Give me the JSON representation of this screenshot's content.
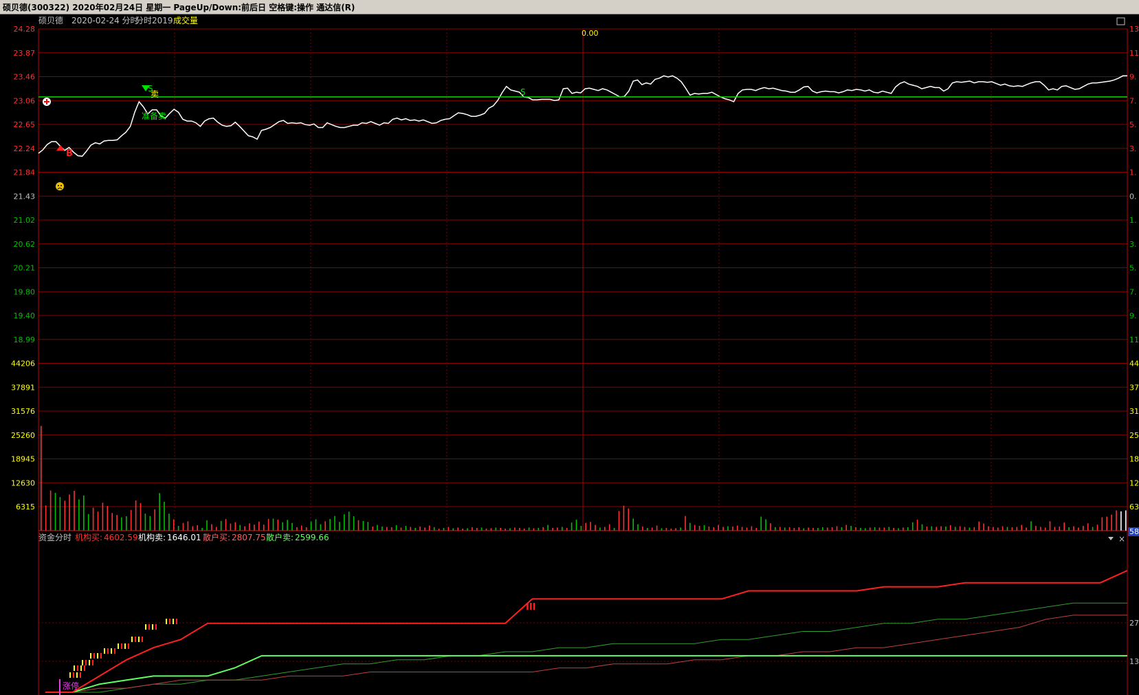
{
  "window": {
    "title": "硕贝德(300322)  2020年02月24日 星期一  PageUp/Down:前后日 空格键:操作 通达信(R)"
  },
  "header": {
    "stock_name": "硕贝德",
    "date_label": "2020-02-24 分时",
    "mode_label": "分时2019",
    "indicator_label": "成交量"
  },
  "colors": {
    "background": "#000000",
    "grid": "#8b0000",
    "price_line": "#ffffff",
    "ref_line": "#00e000",
    "up": "#ff3030",
    "down": "#00c000",
    "yellow": "#ffff00"
  },
  "price_axis": {
    "ticks": [
      "24.28",
      "23.87",
      "23.46",
      "23.06",
      "22.65",
      "22.24",
      "21.84",
      "21.43",
      "21.02",
      "20.62",
      "20.21",
      "19.80",
      "19.40",
      "18.99"
    ],
    "reference": "21.43"
  },
  "right_axis": {
    "price_ticks": [
      "13",
      "11",
      "9.",
      "7.",
      "5.",
      "3.",
      "1.",
      "0.",
      "1.",
      "3.",
      "5.",
      "7.",
      "9.",
      "11"
    ],
    "volume_ticks": [
      "44",
      "37",
      "31",
      "25",
      "18",
      "12",
      "63"
    ],
    "current_badge": "58",
    "fund_ticks": [
      "27",
      "13"
    ]
  },
  "volume_axis": {
    "ticks": [
      "44206",
      "37891",
      "31576",
      "25260",
      "18945",
      "12630",
      "6315"
    ]
  },
  "center_label": "0.00",
  "signals": {
    "buy": "B",
    "sell": "S",
    "sell_text": "卖",
    "prepare_sell": "准备卖",
    "s_marker": "S",
    "limit_up": "涨停",
    "triple_mark": "III"
  },
  "fund_panel": {
    "title": "资金分时",
    "inst_buy_label": "机构买:",
    "inst_buy_value": "4602.59",
    "inst_sell_label": "机构卖:",
    "inst_sell_value": "1646.01",
    "retail_buy_label": "散户买:",
    "retail_buy_value": "2807.75",
    "retail_sell_label": "散户卖:",
    "retail_sell_value": "2599.66"
  },
  "chart_data": {
    "type": "line",
    "price_series": [
      22.16,
      22.22,
      22.31,
      22.36,
      22.36,
      22.28,
      22.21,
      22.26,
      22.18,
      22.12,
      22.11,
      22.2,
      22.3,
      22.34,
      22.32,
      22.37,
      22.38,
      22.38,
      22.39,
      22.46,
      22.52,
      22.62,
      22.86,
      23.04,
      22.95,
      22.83,
      22.9,
      22.9,
      22.8,
      22.76,
      22.84,
      22.91,
      22.86,
      22.74,
      22.71,
      22.71,
      22.68,
      22.62,
      22.71,
      22.75,
      22.76,
      22.69,
      22.64,
      22.62,
      22.63,
      22.69,
      22.62,
      22.54,
      22.46,
      22.44,
      22.4,
      22.55,
      22.57,
      22.6,
      22.65,
      22.7,
      22.72,
      22.67,
      22.68,
      22.67,
      22.68,
      22.65,
      22.64,
      22.66,
      22.6,
      22.6,
      22.68,
      22.65,
      22.62,
      22.6,
      22.6,
      22.62,
      22.64,
      22.64,
      22.68,
      22.67,
      22.7,
      22.67,
      22.64,
      22.68,
      22.67,
      22.74,
      22.76,
      22.73,
      22.75,
      22.72,
      22.73,
      22.71,
      22.73,
      22.7,
      22.67,
      22.68,
      22.72,
      22.74,
      22.75,
      22.8,
      22.85,
      22.84,
      22.82,
      22.79,
      22.79,
      22.81,
      22.84,
      22.93,
      22.97,
      23.06,
      23.19,
      23.3,
      23.24,
      23.22,
      23.2,
      23.12,
      23.11,
      23.07,
      23.07,
      23.08,
      23.08,
      23.08,
      23.06,
      23.07,
      23.26,
      23.27,
      23.18,
      23.2,
      23.19,
      23.26,
      23.27,
      23.25,
      23.23,
      23.26,
      23.24,
      23.2,
      23.16,
      23.12,
      23.13,
      23.22,
      23.39,
      23.41,
      23.33,
      23.36,
      23.34,
      23.42,
      23.44,
      23.48,
      23.46,
      23.48,
      23.44,
      23.38,
      23.27,
      23.15,
      23.18,
      23.17,
      23.18,
      23.18,
      23.2,
      23.16,
      23.12,
      23.09,
      23.07,
      23.04,
      23.18,
      23.24,
      23.25,
      23.25,
      23.23,
      23.26,
      23.28,
      23.26,
      23.27,
      23.25,
      23.23,
      23.22,
      23.2,
      23.2,
      23.24,
      23.29,
      23.3,
      23.22,
      23.19,
      23.21,
      23.22,
      23.21,
      23.21,
      23.19,
      23.21,
      23.24,
      23.23,
      23.25,
      23.24,
      23.22,
      23.24,
      23.2,
      23.19,
      23.22,
      23.2,
      23.18,
      23.29,
      23.35,
      23.38,
      23.34,
      23.32,
      23.3,
      23.26,
      23.28,
      23.3,
      23.28,
      23.28,
      23.22,
      23.26,
      23.36,
      23.38,
      23.37,
      23.38,
      23.39,
      23.36,
      23.38,
      23.38,
      23.37,
      23.38,
      23.35,
      23.32,
      23.34,
      23.31,
      23.3,
      23.31,
      23.3,
      23.33,
      23.36,
      23.38,
      23.38,
      23.32,
      23.24,
      23.26,
      23.24,
      23.3,
      23.31,
      23.28,
      23.25,
      23.26,
      23.3,
      23.34,
      23.36,
      23.36,
      23.37,
      23.38,
      23.39,
      23.41,
      23.44,
      23.48,
      23.48
    ],
    "volume_series": [
      {
        "v": 31600,
        "c": "up"
      },
      {
        "v": 7600,
        "c": "up"
      },
      {
        "v": 12100,
        "c": "up"
      },
      {
        "v": 11400,
        "c": "down"
      },
      {
        "v": 10100,
        "c": "down"
      },
      {
        "v": 9000,
        "c": "up"
      },
      {
        "v": 10900,
        "c": "up"
      },
      {
        "v": 12000,
        "c": "up"
      },
      {
        "v": 9400,
        "c": "down"
      },
      {
        "v": 10600,
        "c": "down"
      },
      {
        "v": 5000,
        "c": "down"
      },
      {
        "v": 6900,
        "c": "up"
      },
      {
        "v": 5700,
        "c": "up"
      },
      {
        "v": 8400,
        "c": "up"
      },
      {
        "v": 7400,
        "c": "up"
      },
      {
        "v": 5300,
        "c": "up"
      },
      {
        "v": 4700,
        "c": "up"
      },
      {
        "v": 4000,
        "c": "down"
      },
      {
        "v": 4300,
        "c": "down"
      },
      {
        "v": 6200,
        "c": "up"
      },
      {
        "v": 9100,
        "c": "up"
      },
      {
        "v": 8300,
        "c": "up"
      },
      {
        "v": 5100,
        "c": "down"
      },
      {
        "v": 4400,
        "c": "down"
      },
      {
        "v": 6400,
        "c": "up"
      },
      {
        "v": 11300,
        "c": "down"
      },
      {
        "v": 8700,
        "c": "down"
      },
      {
        "v": 5100,
        "c": "down"
      },
      {
        "v": 3400,
        "c": "up"
      },
      {
        "v": 1400,
        "c": "down"
      },
      {
        "v": 2300,
        "c": "up"
      },
      {
        "v": 2800,
        "c": "up"
      },
      {
        "v": 1300,
        "c": "up"
      },
      {
        "v": 1600,
        "c": "up"
      },
      {
        "v": 800,
        "c": "down"
      },
      {
        "v": 3100,
        "c": "down"
      },
      {
        "v": 1900,
        "c": "up"
      },
      {
        "v": 1100,
        "c": "up"
      },
      {
        "v": 2900,
        "c": "down"
      },
      {
        "v": 3500,
        "c": "up"
      },
      {
        "v": 2100,
        "c": "up"
      },
      {
        "v": 2500,
        "c": "up"
      },
      {
        "v": 1700,
        "c": "down"
      },
      {
        "v": 1300,
        "c": "up"
      },
      {
        "v": 2200,
        "c": "up"
      },
      {
        "v": 1800,
        "c": "up"
      },
      {
        "v": 2700,
        "c": "up"
      },
      {
        "v": 1800,
        "c": "up"
      },
      {
        "v": 3500,
        "c": "up"
      },
      {
        "v": 3600,
        "c": "down"
      },
      {
        "v": 3300,
        "c": "up"
      },
      {
        "v": 2500,
        "c": "down"
      },
      {
        "v": 3200,
        "c": "down"
      },
      {
        "v": 2300,
        "c": "down"
      },
      {
        "v": 1000,
        "c": "up"
      },
      {
        "v": 1500,
        "c": "up"
      },
      {
        "v": 1000,
        "c": "up"
      },
      {
        "v": 2700,
        "c": "down"
      },
      {
        "v": 3400,
        "c": "down"
      },
      {
        "v": 1900,
        "c": "down"
      },
      {
        "v": 2800,
        "c": "up"
      },
      {
        "v": 3500,
        "c": "down"
      },
      {
        "v": 4400,
        "c": "down"
      },
      {
        "v": 2600,
        "c": "down"
      },
      {
        "v": 4900,
        "c": "down"
      },
      {
        "v": 5700,
        "c": "down"
      },
      {
        "v": 4300,
        "c": "down"
      },
      {
        "v": 3100,
        "c": "up"
      },
      {
        "v": 2900,
        "c": "down"
      },
      {
        "v": 2600,
        "c": "down"
      },
      {
        "v": 1200,
        "c": "up"
      },
      {
        "v": 1700,
        "c": "down"
      },
      {
        "v": 1200,
        "c": "down"
      },
      {
        "v": 1100,
        "c": "up"
      },
      {
        "v": 1000,
        "c": "up"
      },
      {
        "v": 1600,
        "c": "down"
      },
      {
        "v": 900,
        "c": "up"
      },
      {
        "v": 1400,
        "c": "down"
      },
      {
        "v": 1100,
        "c": "up"
      },
      {
        "v": 800,
        "c": "down"
      },
      {
        "v": 1200,
        "c": "up"
      },
      {
        "v": 900,
        "c": "up"
      },
      {
        "v": 1500,
        "c": "up"
      },
      {
        "v": 1000,
        "c": "down"
      },
      {
        "v": 600,
        "c": "up"
      },
      {
        "v": 800,
        "c": "down"
      },
      {
        "v": 1100,
        "c": "up"
      },
      {
        "v": 700,
        "c": "down"
      },
      {
        "v": 900,
        "c": "up"
      },
      {
        "v": 600,
        "c": "up"
      },
      {
        "v": 700,
        "c": "down"
      },
      {
        "v": 1000,
        "c": "up"
      },
      {
        "v": 800,
        "c": "up"
      },
      {
        "v": 900,
        "c": "down"
      },
      {
        "v": 600,
        "c": "up"
      },
      {
        "v": 700,
        "c": "up"
      },
      {
        "v": 900,
        "c": "down"
      },
      {
        "v": 800,
        "c": "up"
      },
      {
        "v": 600,
        "c": "up"
      },
      {
        "v": 700,
        "c": "down"
      },
      {
        "v": 900,
        "c": "up"
      },
      {
        "v": 800,
        "c": "up"
      },
      {
        "v": 600,
        "c": "up"
      },
      {
        "v": 900,
        "c": "down"
      },
      {
        "v": 700,
        "c": "up"
      },
      {
        "v": 800,
        "c": "down"
      },
      {
        "v": 1000,
        "c": "up"
      },
      {
        "v": 1700,
        "c": "down"
      },
      {
        "v": 800,
        "c": "up"
      },
      {
        "v": 900,
        "c": "up"
      },
      {
        "v": 1100,
        "c": "down"
      },
      {
        "v": 800,
        "c": "up"
      },
      {
        "v": 2400,
        "c": "down"
      },
      {
        "v": 3300,
        "c": "down"
      },
      {
        "v": 1400,
        "c": "down"
      },
      {
        "v": 2300,
        "c": "up"
      },
      {
        "v": 2600,
        "c": "up"
      },
      {
        "v": 1700,
        "c": "up"
      },
      {
        "v": 900,
        "c": "down"
      },
      {
        "v": 1100,
        "c": "up"
      },
      {
        "v": 1900,
        "c": "up"
      },
      {
        "v": 800,
        "c": "down"
      },
      {
        "v": 5900,
        "c": "up"
      },
      {
        "v": 7500,
        "c": "up"
      },
      {
        "v": 6700,
        "c": "up"
      },
      {
        "v": 3600,
        "c": "down"
      },
      {
        "v": 1900,
        "c": "down"
      },
      {
        "v": 1200,
        "c": "up"
      },
      {
        "v": 800,
        "c": "down"
      },
      {
        "v": 900,
        "c": "up"
      },
      {
        "v": 1500,
        "c": "up"
      },
      {
        "v": 700,
        "c": "down"
      },
      {
        "v": 800,
        "c": "up"
      },
      {
        "v": 600,
        "c": "up"
      },
      {
        "v": 700,
        "c": "up"
      },
      {
        "v": 900,
        "c": "down"
      },
      {
        "v": 4400,
        "c": "up"
      },
      {
        "v": 2300,
        "c": "down"
      },
      {
        "v": 1700,
        "c": "up"
      },
      {
        "v": 1400,
        "c": "up"
      },
      {
        "v": 1600,
        "c": "down"
      },
      {
        "v": 1200,
        "c": "up"
      },
      {
        "v": 1000,
        "c": "up"
      },
      {
        "v": 1700,
        "c": "up"
      },
      {
        "v": 1100,
        "c": "up"
      },
      {
        "v": 1300,
        "c": "down"
      },
      {
        "v": 1200,
        "c": "up"
      },
      {
        "v": 1500,
        "c": "up"
      },
      {
        "v": 1100,
        "c": "up"
      },
      {
        "v": 900,
        "c": "up"
      },
      {
        "v": 1300,
        "c": "up"
      },
      {
        "v": 800,
        "c": "up"
      },
      {
        "v": 4200,
        "c": "down"
      },
      {
        "v": 3400,
        "c": "down"
      },
      {
        "v": 2200,
        "c": "up"
      },
      {
        "v": 1000,
        "c": "down"
      },
      {
        "v": 1100,
        "c": "up"
      },
      {
        "v": 900,
        "c": "down"
      },
      {
        "v": 1000,
        "c": "up"
      },
      {
        "v": 800,
        "c": "up"
      },
      {
        "v": 1000,
        "c": "up"
      },
      {
        "v": 700,
        "c": "down"
      },
      {
        "v": 900,
        "c": "up"
      },
      {
        "v": 800,
        "c": "up"
      },
      {
        "v": 800,
        "c": "down"
      },
      {
        "v": 1000,
        "c": "down"
      },
      {
        "v": 900,
        "c": "up"
      },
      {
        "v": 1000,
        "c": "up"
      },
      {
        "v": 1300,
        "c": "up"
      },
      {
        "v": 1000,
        "c": "down"
      },
      {
        "v": 1700,
        "c": "up"
      },
      {
        "v": 1400,
        "c": "down"
      },
      {
        "v": 1000,
        "c": "up"
      },
      {
        "v": 800,
        "c": "down"
      },
      {
        "v": 700,
        "c": "down"
      },
      {
        "v": 900,
        "c": "up"
      },
      {
        "v": 1000,
        "c": "down"
      },
      {
        "v": 900,
        "c": "up"
      },
      {
        "v": 900,
        "c": "up"
      },
      {
        "v": 1100,
        "c": "down"
      },
      {
        "v": 800,
        "c": "up"
      },
      {
        "v": 700,
        "c": "down"
      },
      {
        "v": 900,
        "c": "up"
      },
      {
        "v": 1000,
        "c": "down"
      },
      {
        "v": 2500,
        "c": "down"
      },
      {
        "v": 3300,
        "c": "up"
      },
      {
        "v": 1900,
        "c": "down"
      },
      {
        "v": 1200,
        "c": "up"
      },
      {
        "v": 1300,
        "c": "down"
      },
      {
        "v": 1100,
        "c": "up"
      },
      {
        "v": 1300,
        "c": "up"
      },
      {
        "v": 1200,
        "c": "down"
      },
      {
        "v": 1600,
        "c": "up"
      },
      {
        "v": 1100,
        "c": "down"
      },
      {
        "v": 1300,
        "c": "up"
      },
      {
        "v": 1100,
        "c": "up"
      },
      {
        "v": 900,
        "c": "down"
      },
      {
        "v": 1000,
        "c": "up"
      },
      {
        "v": 2700,
        "c": "up"
      },
      {
        "v": 2100,
        "c": "up"
      },
      {
        "v": 1300,
        "c": "up"
      },
      {
        "v": 1100,
        "c": "up"
      },
      {
        "v": 900,
        "c": "up"
      },
      {
        "v": 1300,
        "c": "up"
      },
      {
        "v": 1100,
        "c": "down"
      },
      {
        "v": 1000,
        "c": "up"
      },
      {
        "v": 1100,
        "c": "up"
      },
      {
        "v": 1700,
        "c": "up"
      },
      {
        "v": 900,
        "c": "up"
      },
      {
        "v": 2800,
        "c": "down"
      },
      {
        "v": 1400,
        "c": "up"
      },
      {
        "v": 1100,
        "c": "up"
      },
      {
        "v": 900,
        "c": "up"
      },
      {
        "v": 2800,
        "c": "up"
      },
      {
        "v": 1100,
        "c": "up"
      },
      {
        "v": 1200,
        "c": "up"
      },
      {
        "v": 2400,
        "c": "up"
      },
      {
        "v": 1000,
        "c": "down"
      },
      {
        "v": 1300,
        "c": "up"
      },
      {
        "v": 900,
        "c": "up"
      },
      {
        "v": 1400,
        "c": "up"
      },
      {
        "v": 2200,
        "c": "up"
      },
      {
        "v": 1100,
        "c": "down"
      },
      {
        "v": 1800,
        "c": "up"
      },
      {
        "v": 4000,
        "c": "up"
      },
      {
        "v": 4200,
        "c": "up"
      },
      {
        "v": 4800,
        "c": "up"
      },
      {
        "v": 6100,
        "c": "up"
      },
      {
        "v": 5800,
        "c": "neutral"
      },
      {
        "v": 6100,
        "c": "neutral"
      }
    ],
    "fund_series": {
      "inst_buy": [
        0,
        0,
        4,
        8,
        11,
        13,
        17,
        17,
        17,
        17,
        17,
        17,
        17,
        17,
        17,
        17,
        17,
        17,
        23,
        23,
        23,
        23,
        23,
        23,
        23,
        23,
        25,
        25,
        25,
        25,
        25,
        26,
        26,
        26,
        27,
        27,
        27,
        27,
        27,
        27,
        30
      ],
      "inst_sell": [
        0,
        0,
        2,
        3,
        4,
        4,
        4,
        6,
        9,
        9,
        9,
        9,
        9,
        9,
        9,
        9,
        9,
        9,
        9,
        9,
        9,
        9,
        9,
        9,
        9,
        9,
        9,
        9,
        9,
        9,
        9,
        9,
        9,
        9,
        9,
        9,
        9,
        9,
        9,
        9,
        9
      ],
      "retail_buy": [
        0,
        0,
        1,
        1,
        2,
        3,
        3,
        3,
        3,
        4,
        4,
        4,
        5,
        5,
        5,
        5,
        5,
        5,
        5,
        6,
        6,
        7,
        7,
        7,
        8,
        8,
        9,
        9,
        10,
        10,
        11,
        11,
        12,
        13,
        14,
        15,
        16,
        18,
        19,
        19,
        19
      ],
      "retail_sell": [
        0,
        0,
        0,
        1,
        2,
        2,
        3,
        3,
        4,
        5,
        6,
        7,
        7,
        8,
        8,
        9,
        9,
        10,
        10,
        11,
        11,
        12,
        12,
        12,
        12,
        13,
        13,
        14,
        15,
        15,
        16,
        17,
        17,
        18,
        18,
        19,
        20,
        21,
        22,
        22,
        22
      ]
    }
  }
}
